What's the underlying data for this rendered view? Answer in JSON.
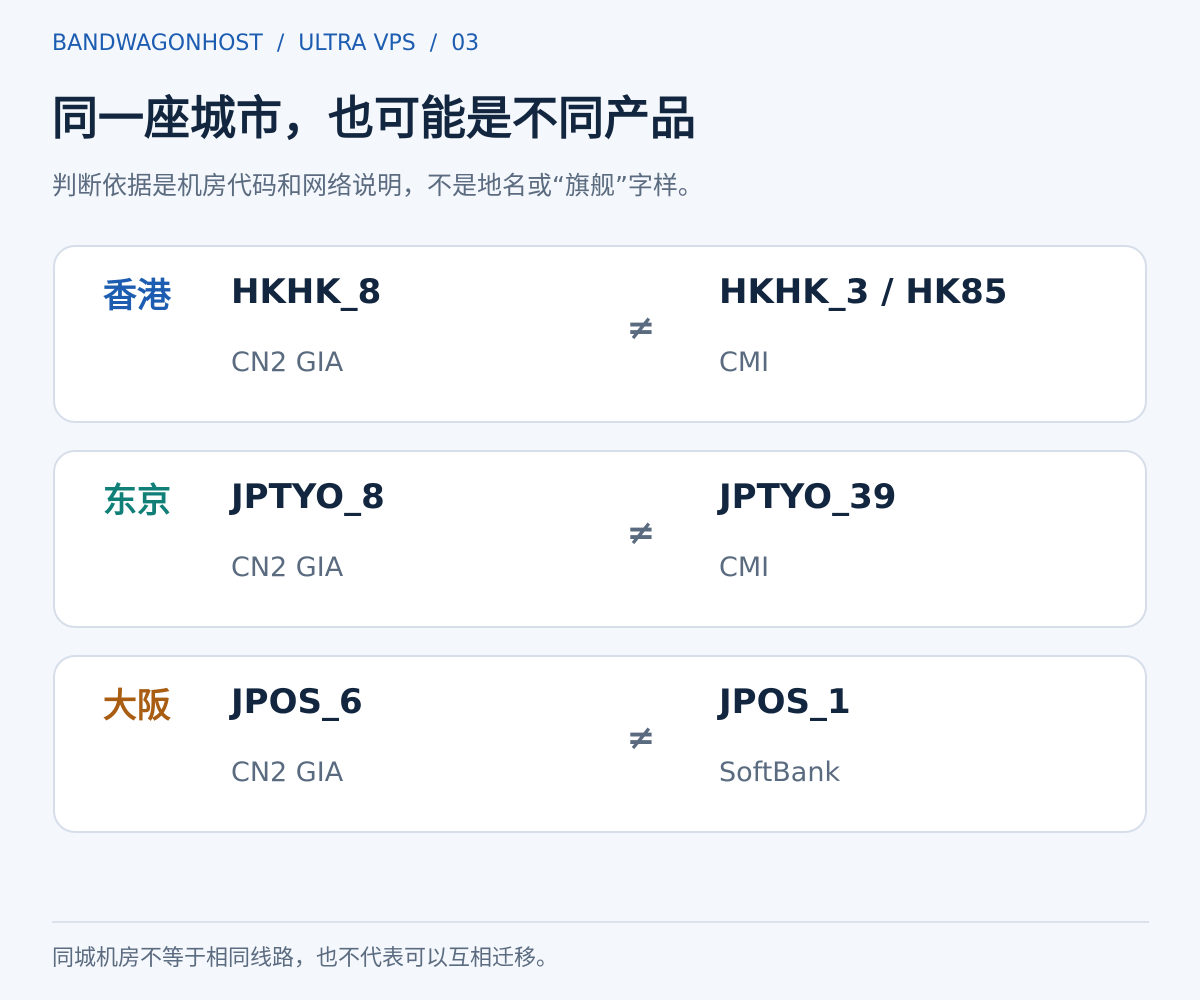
{
  "breadcrumb": {
    "items": [
      "BANDWAGONHOST",
      "ULTRA VPS",
      "03"
    ],
    "separator": "/"
  },
  "title": "同一座城市，也可能是不同产品",
  "subtitle": "判断依据是机房代码和网络说明，不是地名或“旗舰”字样。",
  "comparison_symbol": "≠",
  "cards": [
    {
      "city": "香港",
      "city_color": "#1d5db1",
      "left": {
        "code": "HKHK_8",
        "network": "CN2 GIA"
      },
      "right": {
        "code": "HKHK_3 / HK85",
        "network": "CMI"
      }
    },
    {
      "city": "东京",
      "city_color": "#0f7f78",
      "left": {
        "code": "JPTYO_8",
        "network": "CN2 GIA"
      },
      "right": {
        "code": "JPTYO_39",
        "network": "CMI"
      }
    },
    {
      "city": "大阪",
      "city_color": "#a85d13",
      "left": {
        "code": "JPOS_6",
        "network": "CN2 GIA"
      },
      "right": {
        "code": "JPOS_1",
        "network": "SoftBank"
      }
    }
  ],
  "footer": "同城机房不等于相同线路，也不代表可以互相迁移。",
  "colors": {
    "background": "#f4f7fb",
    "card_background": "#ffffff",
    "card_border": "#d6dee9",
    "accent": "#1d5db1",
    "text_primary": "#13263f",
    "text_secondary": "#5a6b80"
  }
}
